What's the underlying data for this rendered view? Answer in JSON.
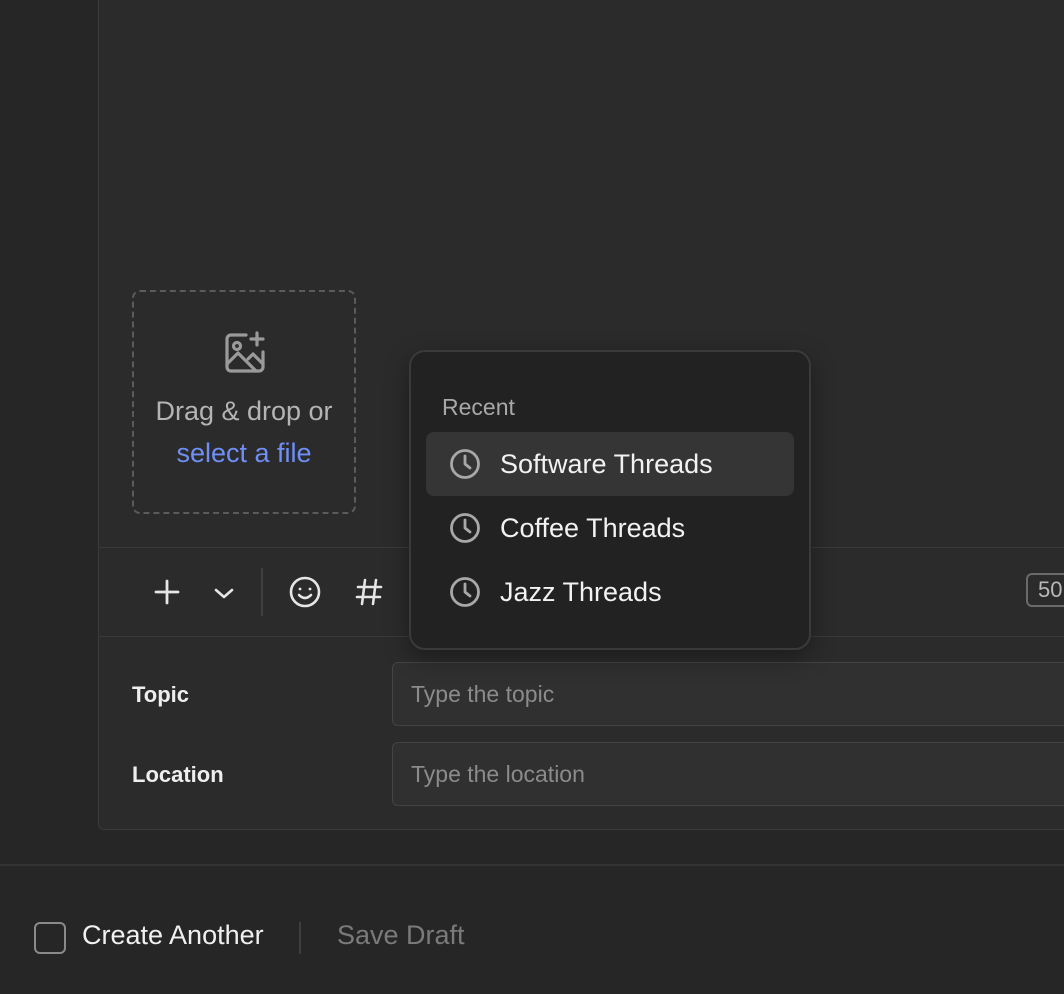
{
  "upload": {
    "drag_text": "Drag & drop or",
    "select_link": "select a file"
  },
  "toolbar": {
    "add_icon": "plus-icon",
    "more_icon": "chevron-down-icon",
    "emoji_icon": "emoji-icon",
    "hashtag_icon": "hashtag-icon",
    "counter": "50"
  },
  "dropdown": {
    "title": "Recent",
    "items": [
      {
        "label": "Software Threads",
        "icon": "clock-icon",
        "active": true
      },
      {
        "label": "Coffee Threads",
        "icon": "clock-icon",
        "active": false
      },
      {
        "label": "Jazz Threads",
        "icon": "clock-icon",
        "active": false
      }
    ]
  },
  "fields": {
    "topic": {
      "label": "Topic",
      "placeholder": "Type the topic",
      "value": ""
    },
    "location": {
      "label": "Location",
      "placeholder": "Type the location",
      "value": ""
    }
  },
  "footer": {
    "create_another": "Create Another",
    "save_draft": "Save Draft"
  },
  "colors": {
    "background": "#262626",
    "panel": "#2b2b2b",
    "link": "#6f8ff7",
    "dropdown_bg": "#222222",
    "active_item": "#353535"
  }
}
